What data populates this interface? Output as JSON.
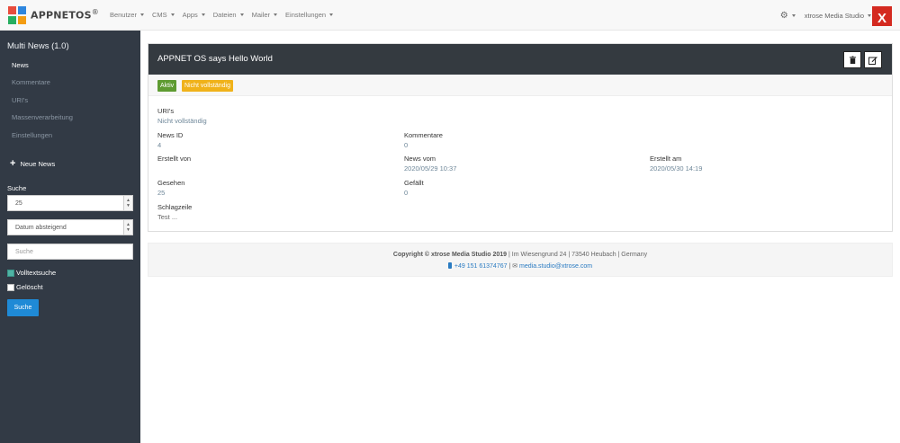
{
  "brand": {
    "name": "APPNETOS",
    "reg": "®"
  },
  "nav": [
    {
      "label": "Benutzer"
    },
    {
      "label": "CMS"
    },
    {
      "label": "Apps"
    },
    {
      "label": "Dateien"
    },
    {
      "label": "Mailer"
    },
    {
      "label": "Einstellungen"
    }
  ],
  "user_menu": {
    "label": "xtrose Media Studio"
  },
  "close_label": "X",
  "sidebar": {
    "title": "Multi News (1.0)",
    "links": [
      {
        "label": "News"
      },
      {
        "label": "Kommentare"
      },
      {
        "label": "URI's"
      },
      {
        "label": "Massenverarbeitung"
      },
      {
        "label": "Einstellungen"
      }
    ],
    "new_news": "Neue News",
    "search_label": "Suche",
    "limit_select": "25",
    "sort_select": "Datum absteigend",
    "search_placeholder": "Suche",
    "fulltext_label": "Volltextsuche",
    "deleted_label": "Gelöscht",
    "search_button": "Suche"
  },
  "panel": {
    "title": "APPNET OS says Hello World",
    "badges": {
      "active": "Aktiv",
      "incomplete": "Nicht vollständig"
    },
    "fields": {
      "uris_label": "URI's",
      "uris_value": "Nicht vollständig",
      "news_id_label": "News ID",
      "news_id_value": "4",
      "comments_label": "Kommentare",
      "comments_value": "0",
      "created_by_label": "Erstellt von",
      "created_by_value": "",
      "news_date_label": "News vom",
      "news_date_value": "2020/05/29 10:37",
      "created_at_label": "Erstellt am",
      "created_at_value": "2020/05/30 14:19",
      "seen_label": "Gesehen",
      "seen_value": "25",
      "liked_label": "Gefällt",
      "liked_value": "0",
      "headline_label": "Schlagzeile",
      "headline_value": "Test ..."
    }
  },
  "footer": {
    "copyright": "Copyright © xtrose Media Studio 2019",
    "address": " | Im Wiesengrund 24 | 73540 Heubach | Germany",
    "phone": "+49 151 61374767",
    "email_sep": " | ✉ ",
    "email": "media.studio@xtrose.com"
  }
}
